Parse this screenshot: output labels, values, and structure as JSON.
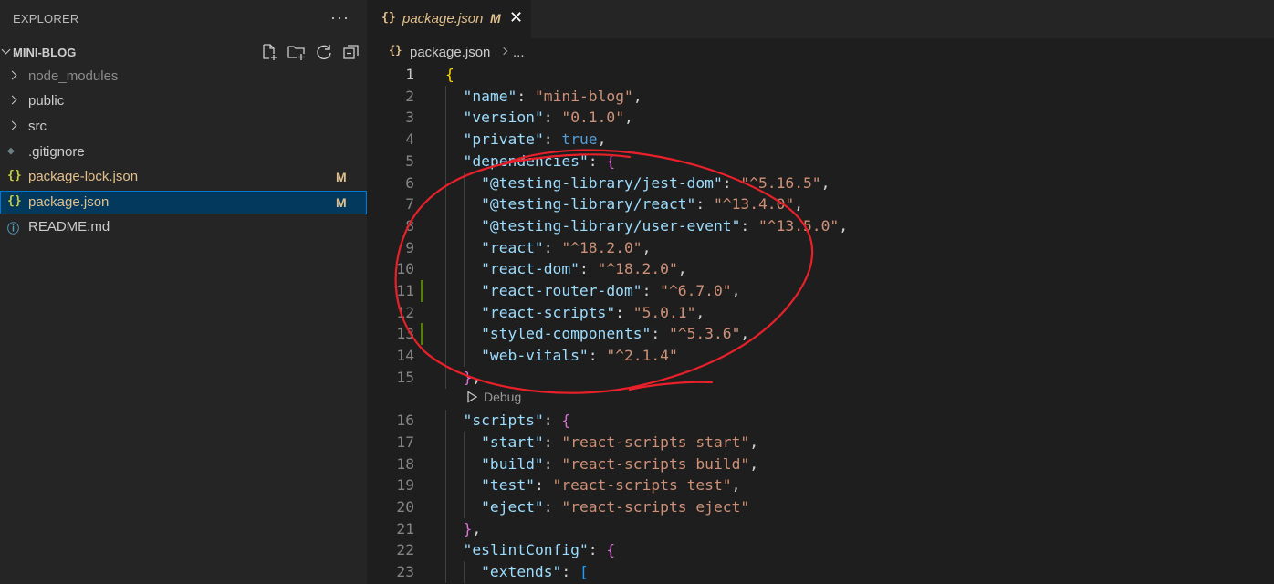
{
  "sidebar": {
    "title": "EXPLORER",
    "more_label": "···",
    "section_name": "MINI-BLOG",
    "actions": [
      {
        "icon": "new-file-icon"
      },
      {
        "icon": "new-folder-icon"
      },
      {
        "icon": "refresh-icon"
      },
      {
        "icon": "collapse-all-icon"
      }
    ],
    "items": [
      {
        "label": "node_modules",
        "kind": "folder",
        "color": "#8b8b8b"
      },
      {
        "label": "public",
        "kind": "folder",
        "color": "#cccccc"
      },
      {
        "label": "src",
        "kind": "folder",
        "color": "#cccccc"
      },
      {
        "label": ".gitignore",
        "kind": "file",
        "icon": "gitignore-icon",
        "glyph": "◆",
        "color": "#cccccc",
        "icon_color": "#6d8086"
      },
      {
        "label": "package-lock.json",
        "kind": "file",
        "icon": "json-icon",
        "glyph": "{}",
        "color": "#e2c08d",
        "icon_color": "#cbcb41",
        "badge": "M"
      },
      {
        "label": "package.json",
        "kind": "file",
        "icon": "json-icon",
        "glyph": "{}",
        "color": "#e2c08d",
        "icon_color": "#cbcb41",
        "badge": "M",
        "selected": true
      },
      {
        "label": "README.md",
        "kind": "file",
        "icon": "info-icon",
        "glyph": "ⓘ",
        "color": "#cccccc",
        "icon_color": "#519aba"
      }
    ]
  },
  "editor": {
    "tab": {
      "icon_glyph": "{}",
      "label": "package.json",
      "modified": "M",
      "close": "✕"
    },
    "breadcrumb": {
      "icon_glyph": "{}",
      "file": "package.json",
      "more": "..."
    },
    "codelens": "Debug",
    "lines": [
      {
        "n": "1",
        "tokens": [
          [
            "b1",
            "{"
          ]
        ]
      },
      {
        "n": "2",
        "indent": 1,
        "tokens": [
          [
            "key",
            "\"name\""
          ],
          [
            "p",
            ": "
          ],
          [
            "str",
            "\"mini-blog\""
          ],
          [
            "p",
            ","
          ]
        ]
      },
      {
        "n": "3",
        "indent": 1,
        "tokens": [
          [
            "key",
            "\"version\""
          ],
          [
            "p",
            ": "
          ],
          [
            "str",
            "\"0.1.0\""
          ],
          [
            "p",
            ","
          ]
        ]
      },
      {
        "n": "4",
        "indent": 1,
        "tokens": [
          [
            "key",
            "\"private\""
          ],
          [
            "p",
            ": "
          ],
          [
            "kw",
            "true"
          ],
          [
            "p",
            ","
          ]
        ]
      },
      {
        "n": "5",
        "indent": 1,
        "tokens": [
          [
            "key",
            "\"dependencies\""
          ],
          [
            "p",
            ": "
          ],
          [
            "b2",
            "{"
          ]
        ]
      },
      {
        "n": "6",
        "indent": 2,
        "tokens": [
          [
            "key",
            "\"@testing-library/jest-dom\""
          ],
          [
            "p",
            ": "
          ],
          [
            "str",
            "\"^5.16.5\""
          ],
          [
            "p",
            ","
          ]
        ]
      },
      {
        "n": "7",
        "indent": 2,
        "tokens": [
          [
            "key",
            "\"@testing-library/react\""
          ],
          [
            "p",
            ": "
          ],
          [
            "str",
            "\"^13.4.0\""
          ],
          [
            "p",
            ","
          ]
        ]
      },
      {
        "n": "8",
        "indent": 2,
        "tokens": [
          [
            "key",
            "\"@testing-library/user-event\""
          ],
          [
            "p",
            ": "
          ],
          [
            "str",
            "\"^13.5.0\""
          ],
          [
            "p",
            ","
          ]
        ]
      },
      {
        "n": "9",
        "indent": 2,
        "tokens": [
          [
            "key",
            "\"react\""
          ],
          [
            "p",
            ": "
          ],
          [
            "str",
            "\"^18.2.0\""
          ],
          [
            "p",
            ","
          ]
        ]
      },
      {
        "n": "10",
        "indent": 2,
        "tokens": [
          [
            "key",
            "\"react-dom\""
          ],
          [
            "p",
            ": "
          ],
          [
            "str",
            "\"^18.2.0\""
          ],
          [
            "p",
            ","
          ]
        ]
      },
      {
        "n": "11",
        "indent": 2,
        "modified": true,
        "tokens": [
          [
            "key",
            "\"react-router-dom\""
          ],
          [
            "p",
            ": "
          ],
          [
            "str",
            "\"^6.7.0\""
          ],
          [
            "p",
            ","
          ]
        ]
      },
      {
        "n": "12",
        "indent": 2,
        "tokens": [
          [
            "key",
            "\"react-scripts\""
          ],
          [
            "p",
            ": "
          ],
          [
            "str",
            "\"5.0.1\""
          ],
          [
            "p",
            ","
          ]
        ]
      },
      {
        "n": "13",
        "indent": 2,
        "modified": true,
        "tokens": [
          [
            "key",
            "\"styled-components\""
          ],
          [
            "p",
            ": "
          ],
          [
            "str",
            "\"^5.3.6\""
          ],
          [
            "p",
            ","
          ]
        ]
      },
      {
        "n": "14",
        "indent": 2,
        "tokens": [
          [
            "key",
            "\"web-vitals\""
          ],
          [
            "p",
            ": "
          ],
          [
            "str",
            "\"^2.1.4\""
          ]
        ]
      },
      {
        "n": "15",
        "indent": 1,
        "tokens": [
          [
            "b2",
            "}"
          ],
          [
            "p",
            ","
          ]
        ]
      },
      {
        "n": "16",
        "indent": 1,
        "tokens": [
          [
            "key",
            "\"scripts\""
          ],
          [
            "p",
            ": "
          ],
          [
            "b2",
            "{"
          ]
        ]
      },
      {
        "n": "17",
        "indent": 2,
        "tokens": [
          [
            "key",
            "\"start\""
          ],
          [
            "p",
            ": "
          ],
          [
            "str",
            "\"react-scripts start\""
          ],
          [
            "p",
            ","
          ]
        ]
      },
      {
        "n": "18",
        "indent": 2,
        "tokens": [
          [
            "key",
            "\"build\""
          ],
          [
            "p",
            ": "
          ],
          [
            "str",
            "\"react-scripts build\""
          ],
          [
            "p",
            ","
          ]
        ]
      },
      {
        "n": "19",
        "indent": 2,
        "tokens": [
          [
            "key",
            "\"test\""
          ],
          [
            "p",
            ": "
          ],
          [
            "str",
            "\"react-scripts test\""
          ],
          [
            "p",
            ","
          ]
        ]
      },
      {
        "n": "20",
        "indent": 2,
        "tokens": [
          [
            "key",
            "\"eject\""
          ],
          [
            "p",
            ": "
          ],
          [
            "str",
            "\"react-scripts eject\""
          ]
        ]
      },
      {
        "n": "21",
        "indent": 1,
        "tokens": [
          [
            "b2",
            "}"
          ],
          [
            "p",
            ","
          ]
        ]
      },
      {
        "n": "22",
        "indent": 1,
        "tokens": [
          [
            "key",
            "\"eslintConfig\""
          ],
          [
            "p",
            ": "
          ],
          [
            "b2",
            "{"
          ]
        ]
      },
      {
        "n": "23",
        "indent": 2,
        "tokens": [
          [
            "key",
            "\"extends\""
          ],
          [
            "p",
            ": "
          ],
          [
            "b3",
            "["
          ]
        ]
      }
    ]
  },
  "colors": {
    "sidebar_bg": "#252526",
    "editor_bg": "#1e1e1e",
    "selection_bg": "#04395e",
    "selection_border": "#0078d4",
    "modified_text": "#e2c08d",
    "gutter_added": "#587c0c",
    "annotation_red": "#e8202a"
  }
}
